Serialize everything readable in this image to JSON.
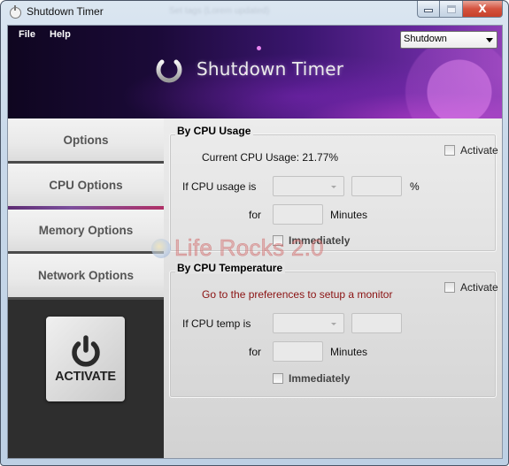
{
  "window": {
    "title": "Shutdown Timer",
    "background_title_ghost": "Set tags (Lorem updated)",
    "controls": {
      "minimize": "minimize",
      "maximize": "maximize",
      "close": "X"
    }
  },
  "menu": {
    "items": [
      {
        "label": "File"
      },
      {
        "label": "Help"
      }
    ]
  },
  "header": {
    "app_name": "Shutdown Timer",
    "action_select": {
      "value": "Shutdown"
    }
  },
  "sidebar": {
    "items": [
      {
        "label": "Options",
        "active": false
      },
      {
        "label": "CPU Options",
        "active": true
      },
      {
        "label": "Memory Options",
        "active": false
      },
      {
        "label": "Network Options",
        "active": false
      }
    ],
    "activate_button": {
      "label": "ACTIVATE"
    }
  },
  "cpu_usage": {
    "title": "By CPU Usage",
    "activate_label": "Activate",
    "activate_checked": false,
    "status": "Current CPU Usage: 21.77%",
    "condition_label": "If CPU usage is",
    "condition_value": "",
    "threshold_value": "",
    "threshold_unit": "%",
    "for_label": "for",
    "minutes_value": "",
    "minutes_unit": "Minutes",
    "immediately_label": "Immediately",
    "immediately_checked": false
  },
  "cpu_temperature": {
    "title": "By CPU Temperature",
    "activate_label": "Activate",
    "activate_checked": false,
    "status": "Go to the preferences to setup a monitor",
    "condition_label": "If CPU temp is",
    "condition_value": "",
    "threshold_value": "",
    "for_label": "for",
    "minutes_value": "",
    "minutes_unit": "Minutes",
    "immediately_label": "Immediately",
    "immediately_checked": false
  },
  "watermark": {
    "text": "Life Rocks 2.0"
  },
  "colors": {
    "warning_text": "#8b1212",
    "active_tab_accent_start": "#5d2c72",
    "active_tab_accent_end": "#b03066",
    "banner_purple": "#6a2aa0",
    "close_button": "#c7402b"
  }
}
